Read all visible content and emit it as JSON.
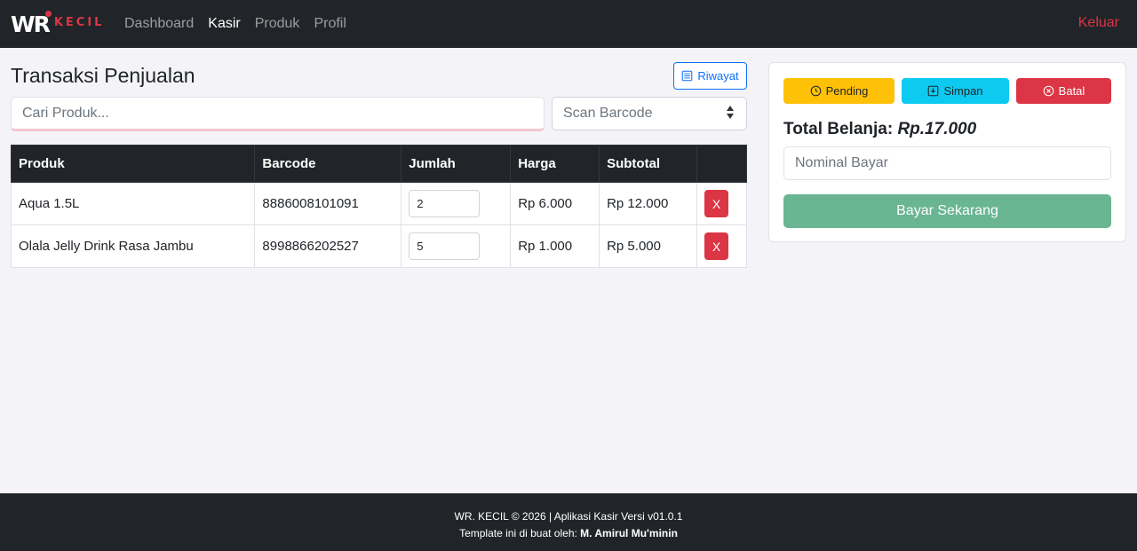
{
  "brand": {
    "wr": "WR",
    "kecil": "KECIL",
    "dot_color": "#dc3545"
  },
  "nav": {
    "items": [
      {
        "label": "Dashboard",
        "active": false
      },
      {
        "label": "Kasir",
        "active": true
      },
      {
        "label": "Produk",
        "active": false
      },
      {
        "label": "Profil",
        "active": false
      }
    ],
    "logout": "Keluar"
  },
  "main": {
    "title": "Transaksi Penjualan",
    "riwayat_label": "Riwayat",
    "search_placeholder": "Cari Produk...",
    "scan_placeholder": "Scan Barcode"
  },
  "table": {
    "headers": [
      "Produk",
      "Barcode",
      "Jumlah",
      "Harga",
      "Subtotal",
      ""
    ],
    "rows": [
      {
        "produk": "Aqua 1.5L",
        "barcode": "8886008101091",
        "jumlah": "2",
        "harga": "Rp 6.000",
        "subtotal": "Rp 12.000",
        "delete": "X"
      },
      {
        "produk": "Olala Jelly Drink Rasa Jambu",
        "barcode": "8998866202527",
        "jumlah": "5",
        "harga": "Rp 1.000",
        "subtotal": "Rp 5.000",
        "delete": "X"
      }
    ]
  },
  "payment": {
    "pending_label": "Pending",
    "simpan_label": "Simpan",
    "batal_label": "Batal",
    "total_label": "Total Belanja:",
    "total_value": "Rp.17.000",
    "nominal_placeholder": "Nominal Bayar",
    "pay_label": "Bayar Sekarang"
  },
  "footer": {
    "line1": "WR. KECIL © 2026 | Aplikasi Kasir Versi v01.0.1",
    "line2_prefix": "Template ini di buat oleh:",
    "line2_author": "M. Amirul Mu'minin"
  },
  "colors": {
    "navbar": "#212529",
    "danger": "#dc3545",
    "primary": "#0d6efd",
    "warning": "#ffc107",
    "info": "#0dcaf0",
    "success_muted": "#6ab592"
  }
}
